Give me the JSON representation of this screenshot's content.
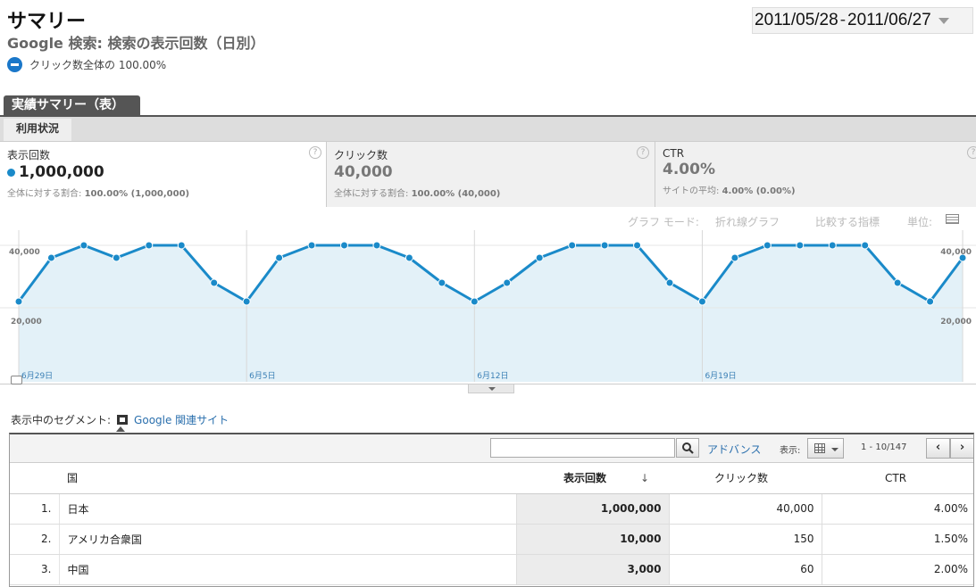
{
  "header": {
    "title": "サマリー",
    "subtitle": "Google 検索: 検索の表示回数（日別）",
    "segment_summary": "クリック数全体の 100.00%"
  },
  "date_range": {
    "start": "2011/05/28",
    "separator": "-",
    "end": "2011/06/27"
  },
  "tabs": {
    "main": "実績サマリー（表）",
    "sub": "利用状況"
  },
  "metrics": [
    {
      "label": "表示回数",
      "value": "1,000,000",
      "sub_label": "全体に対する割合:",
      "sub_value": "100.00% (1,000,000)"
    },
    {
      "label": "クリック数",
      "value": "40,000",
      "sub_label": "全体に対する割合:",
      "sub_value": "100.00% (40,000)"
    },
    {
      "label": "CTR",
      "value": "4.00%",
      "sub_label": "サイトの平均:",
      "sub_value": "4.00% (0.00%)"
    }
  ],
  "graph_options": {
    "mode_label": "グラフ モード:",
    "mode_value": "折れ線グラフ",
    "compare": "比較する指標",
    "unit": "単位:"
  },
  "chart_data": {
    "type": "area",
    "x": [
      "5/28",
      "5/29",
      "5/30",
      "5/31",
      "6/1",
      "6/2",
      "6/3",
      "6/4",
      "6/5",
      "6/6",
      "6/7",
      "6/8",
      "6/9",
      "6/10",
      "6/11",
      "6/12",
      "6/13",
      "6/14",
      "6/15",
      "6/16",
      "6/17",
      "6/18",
      "6/19",
      "6/20",
      "6/21",
      "6/22",
      "6/23",
      "6/24",
      "6/25",
      "6/26",
      "6/27"
    ],
    "series": [
      {
        "values": [
          22000,
          36000,
          40000,
          36000,
          40000,
          40000,
          28000,
          22000,
          36000,
          40000,
          40000,
          40000,
          36000,
          28000,
          22000,
          28000,
          36000,
          40000,
          40000,
          40000,
          28000,
          22000,
          36000,
          40000,
          40000,
          40000,
          40000,
          28000,
          22000,
          36000
        ]
      }
    ],
    "x_tick_labels": [
      {
        "index": 1,
        "label": "6月29日"
      },
      {
        "index": 8,
        "label": "6月5日"
      },
      {
        "index": 15,
        "label": "6月12日"
      },
      {
        "index": 22,
        "label": "6月19日"
      }
    ],
    "y_tick_labels": [
      "40,000",
      "20,000"
    ],
    "ylim": [
      0,
      48000
    ],
    "colors": {
      "line": "#1a8ac9",
      "fill": "#e3f1f8",
      "point": "#1a8ac9"
    }
  },
  "segment": {
    "label": "表示中のセグメント:",
    "value": "Google 関連サイト"
  },
  "table_toolbar": {
    "search_value": "",
    "advanced": "アドバンス",
    "view_label": "表示:",
    "pagination": "1 - 10/147",
    "prev": "‹",
    "next": "›"
  },
  "table": {
    "headers": {
      "country": "国",
      "impressions": "表示回数",
      "sort_indicator": "↓",
      "clicks": "クリック数",
      "ctr": "CTR"
    },
    "rows": [
      {
        "num": "1.",
        "country": "日本",
        "impressions": "1,000,000",
        "clicks": "40,000",
        "ctr": "4.00%"
      },
      {
        "num": "2.",
        "country": "アメリカ合衆国",
        "impressions": "10,000",
        "clicks": "150",
        "ctr": "1.50%"
      },
      {
        "num": "3.",
        "country": "中国",
        "impressions": "3,000",
        "clicks": "60",
        "ctr": "2.00%"
      }
    ]
  }
}
